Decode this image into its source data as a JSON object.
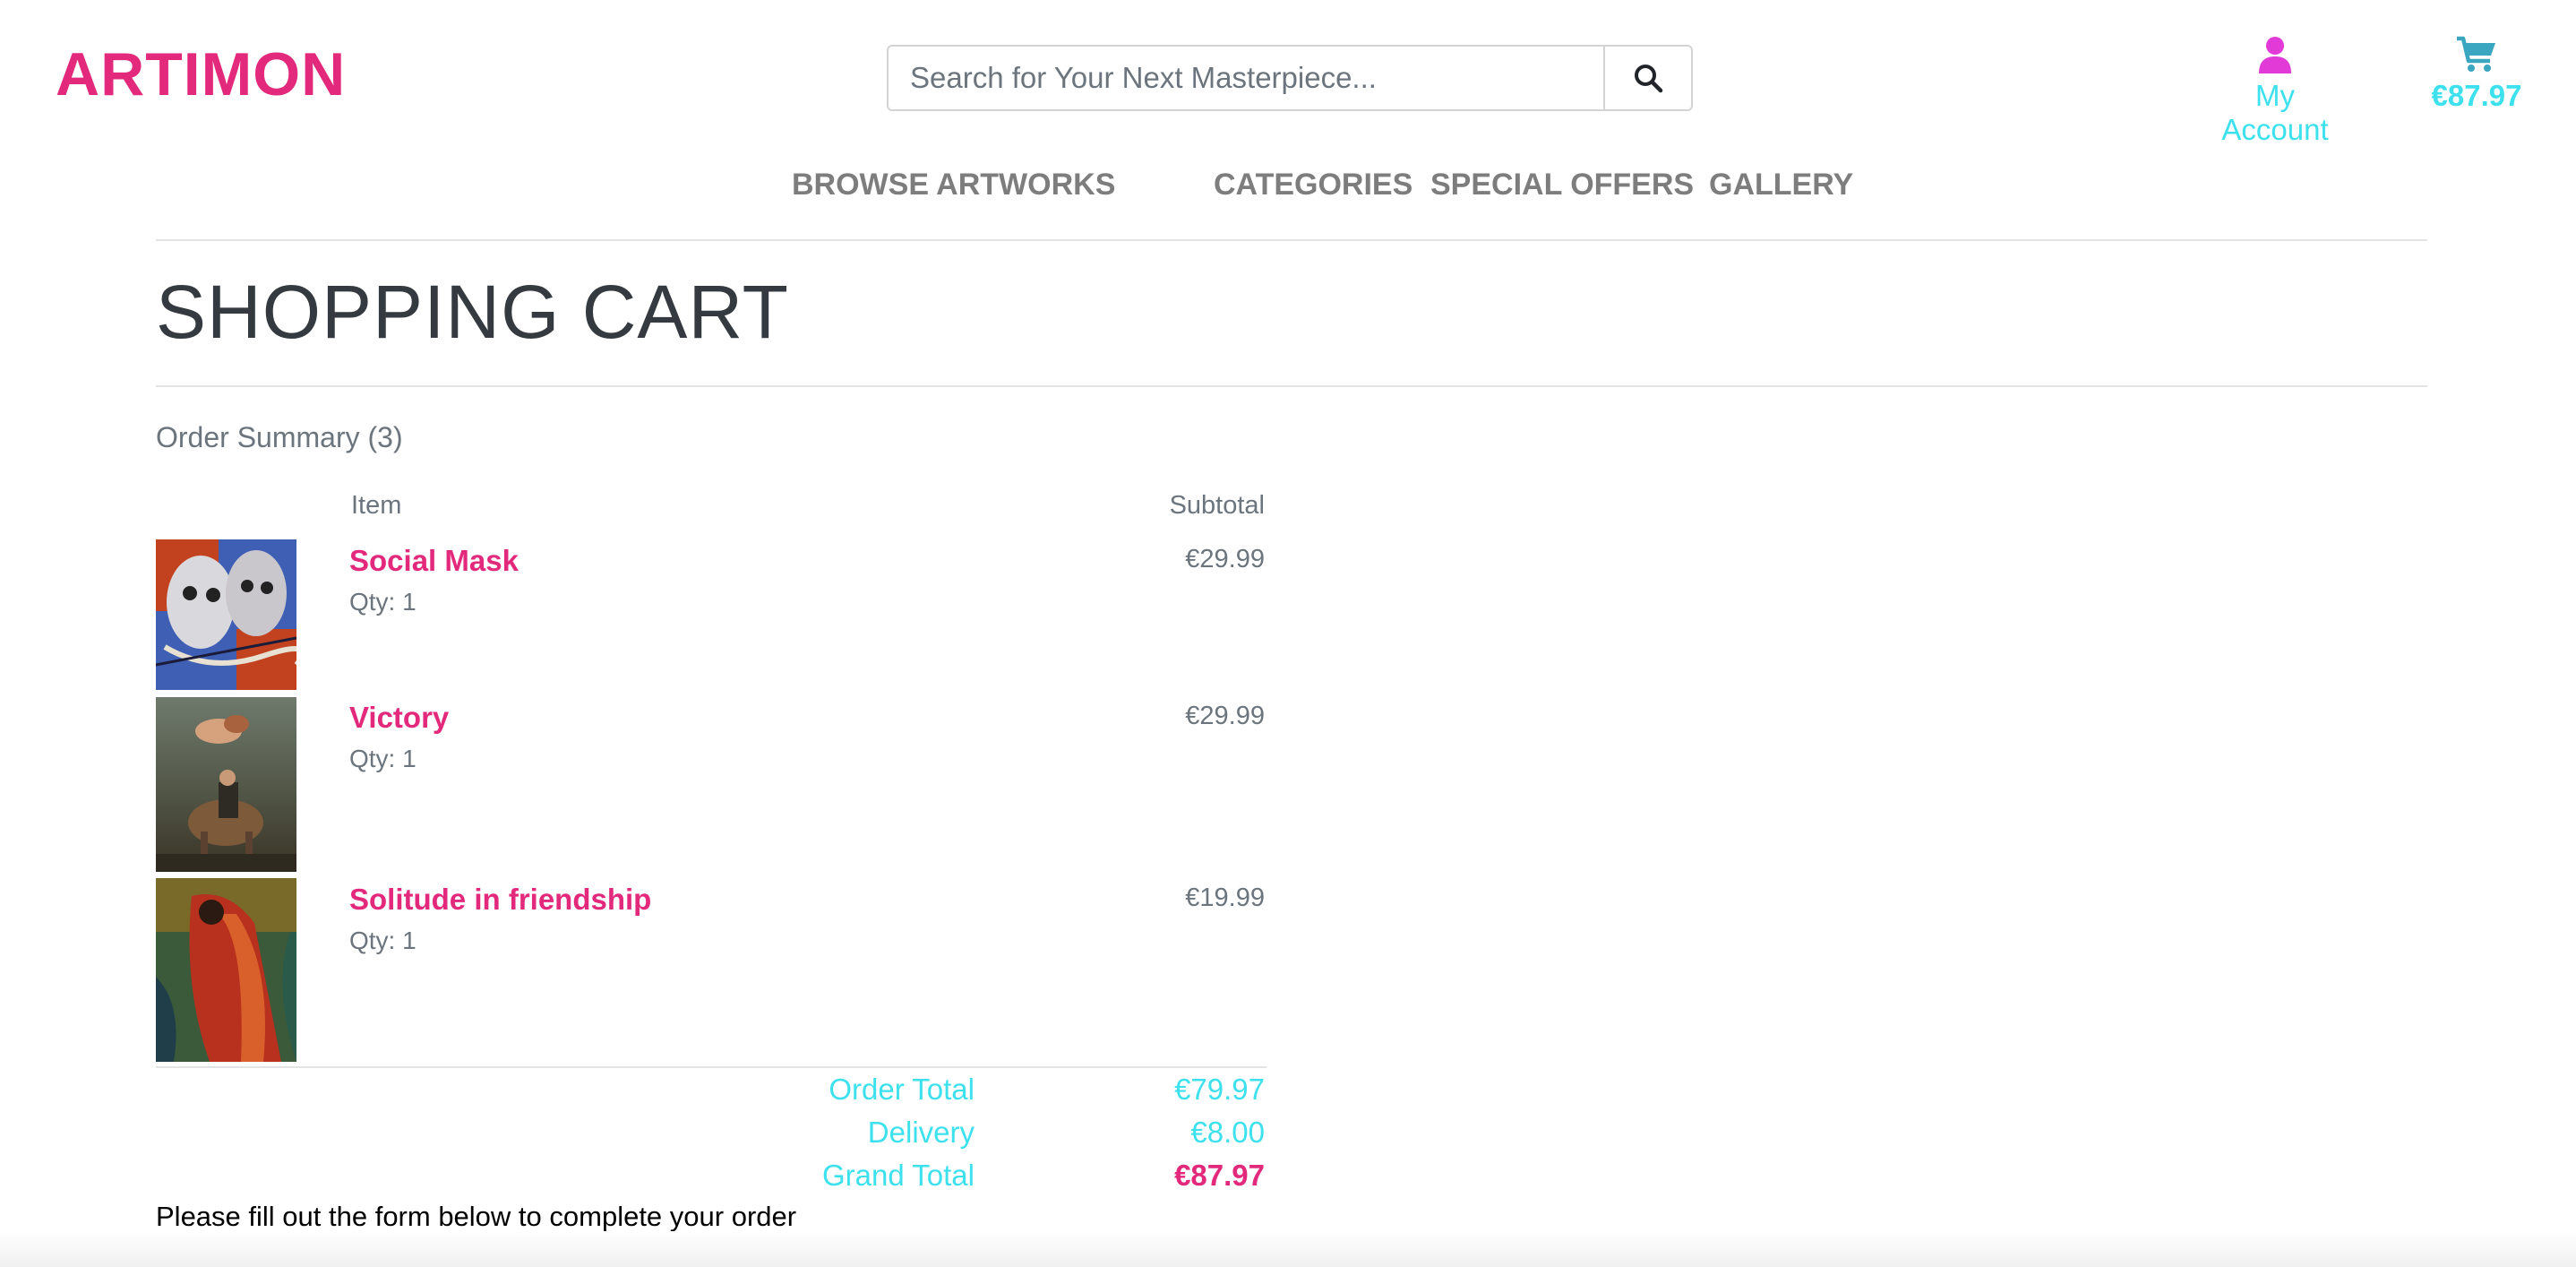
{
  "brand": {
    "logo": "ARTIMON"
  },
  "search": {
    "placeholder": "Search for Your Next Masterpiece...",
    "icon": "search-icon"
  },
  "header": {
    "account_label": "My Account",
    "account_icon": "user-icon",
    "cart_total": "€87.97",
    "cart_icon": "cart-icon"
  },
  "nav": {
    "items": [
      {
        "label": "BROWSE ARTWORKS"
      },
      {
        "label": "CATEGORIES"
      },
      {
        "label": "SPECIAL OFFERS"
      },
      {
        "label": "GALLERY"
      }
    ]
  },
  "page": {
    "title": "SHOPPING CART"
  },
  "cart": {
    "summary": "Order Summary (3)",
    "col_item": "Item",
    "col_subtotal": "Subtotal",
    "items": [
      {
        "name": "Social Mask",
        "qty": "Qty: 1",
        "price": "€29.99"
      },
      {
        "name": "Victory",
        "qty": "Qty: 1",
        "price": "€29.99"
      },
      {
        "name": "Solitude in friendship",
        "qty": "Qty: 1",
        "price": "€19.99"
      }
    ],
    "totals": {
      "order_total_label": "Order Total",
      "order_total": "€79.97",
      "delivery_label": "Delivery",
      "delivery": "€8.00",
      "grand_total_label": "Grand Total",
      "grand_total": "€87.97"
    },
    "note": "Please fill out the form below to complete your order"
  },
  "colors": {
    "brand": "#e2297c",
    "accent": "#3de1ee",
    "account_icon": "#e23ad6",
    "cart_icon": "#3aa6bf"
  }
}
